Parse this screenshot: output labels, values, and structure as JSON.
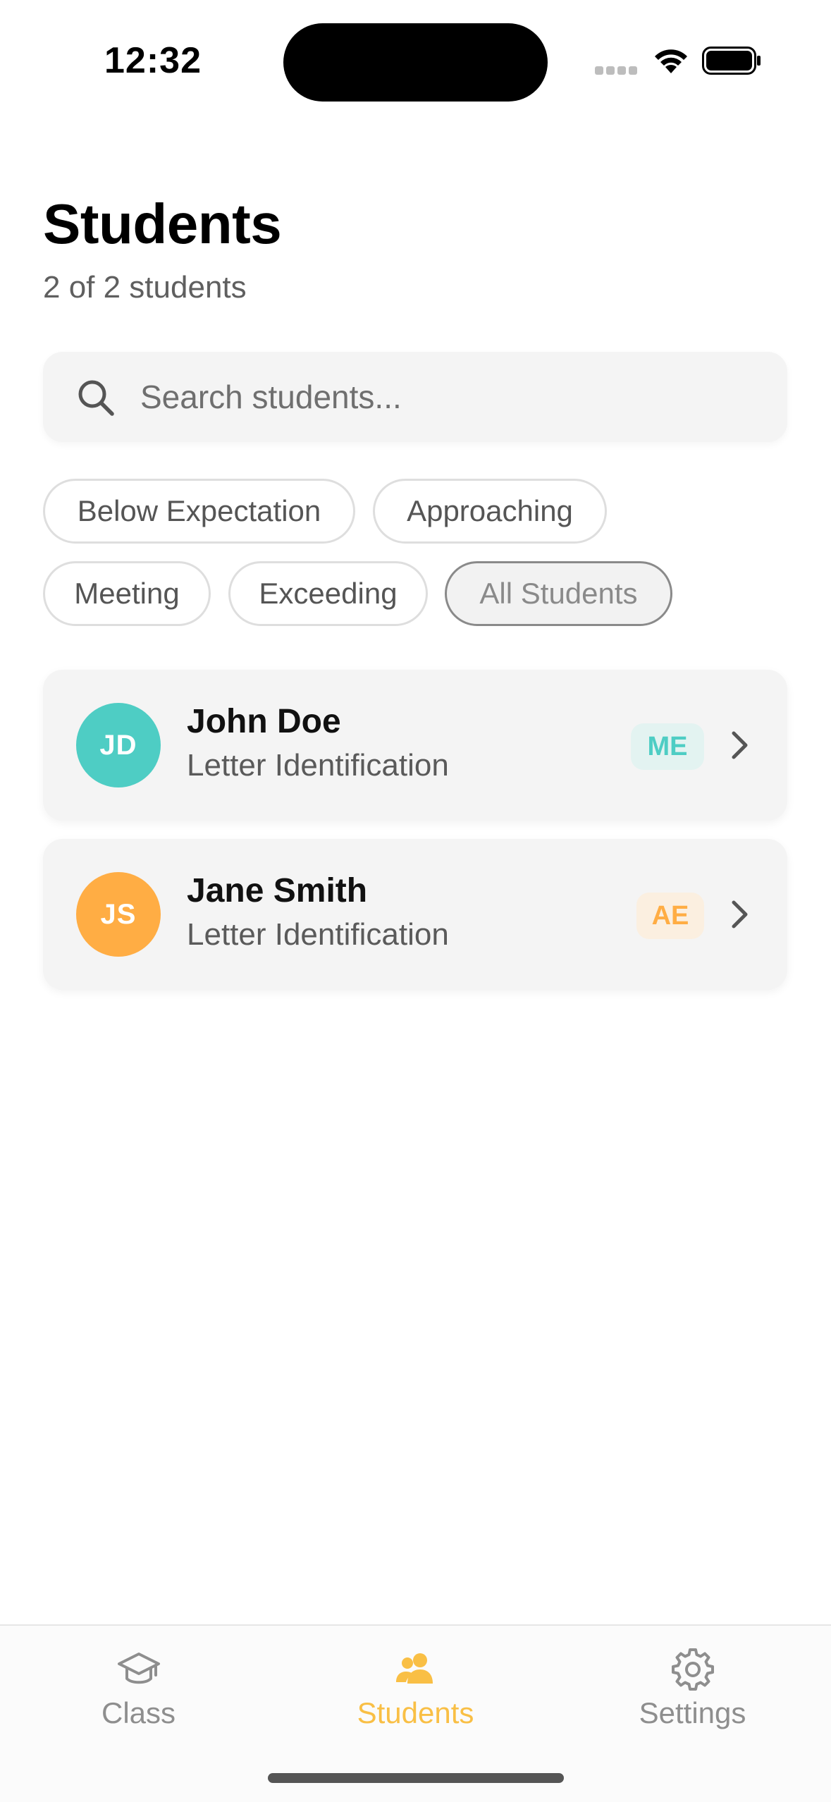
{
  "status_bar": {
    "time": "12:32"
  },
  "header": {
    "title": "Students",
    "subtitle": "2 of 2 students"
  },
  "search": {
    "placeholder": "Search students..."
  },
  "filters": [
    {
      "label": "Below Expectation",
      "active": false
    },
    {
      "label": "Approaching",
      "active": false
    },
    {
      "label": "Meeting",
      "active": false
    },
    {
      "label": "Exceeding",
      "active": false
    },
    {
      "label": "All Students",
      "active": true
    }
  ],
  "students": [
    {
      "initials": "JD",
      "name": "John Doe",
      "skill": "Letter Identification",
      "level": "ME",
      "avatar_color": "#4ecdc4",
      "badge_bg": "#e3f3f1",
      "badge_color": "#4ecdc4"
    },
    {
      "initials": "JS",
      "name": "Jane Smith",
      "skill": "Letter Identification",
      "level": "AE",
      "avatar_color": "#ffad44",
      "badge_bg": "#fbefe0",
      "badge_color": "#ffad44"
    }
  ],
  "tab_bar": {
    "tabs": [
      {
        "label": "Class",
        "icon": "graduation-cap-icon",
        "active": false
      },
      {
        "label": "Students",
        "icon": "people-icon",
        "active": true
      },
      {
        "label": "Settings",
        "icon": "gear-icon",
        "active": false
      }
    ],
    "active_color": "#f9bf45",
    "inactive_color": "#8e8e8e"
  }
}
